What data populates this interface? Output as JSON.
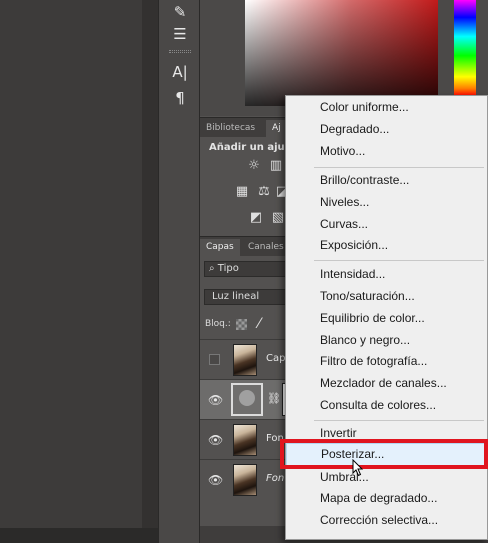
{
  "toolbar": {
    "tools": [
      {
        "icon": "brush-tool-icon",
        "glyph": "✎"
      },
      {
        "icon": "sliders-tool-icon",
        "glyph": "☰"
      },
      {
        "icon": "character-icon",
        "glyph": "A|"
      },
      {
        "icon": "paragraph-icon",
        "glyph": "¶"
      }
    ]
  },
  "adjustments": {
    "tabs": [
      "Bibliotecas",
      "Aj"
    ],
    "title": "Añadir un ajust"
  },
  "layers": {
    "tabs": [
      "Capas",
      "Canales"
    ],
    "search_value": "Tipo",
    "blend_mode": "Luz lineal",
    "lock_label": "Bloq.:",
    "rows": [
      {
        "name": "Capa",
        "visible": false,
        "italic": false
      },
      {
        "name": "",
        "visible": true,
        "italic": false
      },
      {
        "name": "Fon",
        "visible": true,
        "italic": false
      },
      {
        "name": "Fon",
        "visible": true,
        "italic": true
      }
    ]
  },
  "menu": {
    "groups": [
      [
        "Color uniforme...",
        "Degradado...",
        "Motivo..."
      ],
      [
        "Brillo/contraste...",
        "Niveles...",
        "Curvas...",
        "Exposición..."
      ],
      [
        "Intensidad...",
        "Tono/saturación...",
        "Equilibrio de color...",
        "Blanco y negro...",
        "Filtro de fotografía...",
        "Mezclador de canales...",
        "Consulta de colores..."
      ],
      [
        "Invertir",
        "Posterizar...",
        "Umbral...",
        "Mapa de degradado...",
        "Corrección selectiva..."
      ]
    ],
    "highlighted": "Posterizar..."
  },
  "colors": {
    "highlight_border": "#e0151f",
    "menu_hover_bg": "#e4f1fc",
    "panel_bg": "#535150"
  }
}
